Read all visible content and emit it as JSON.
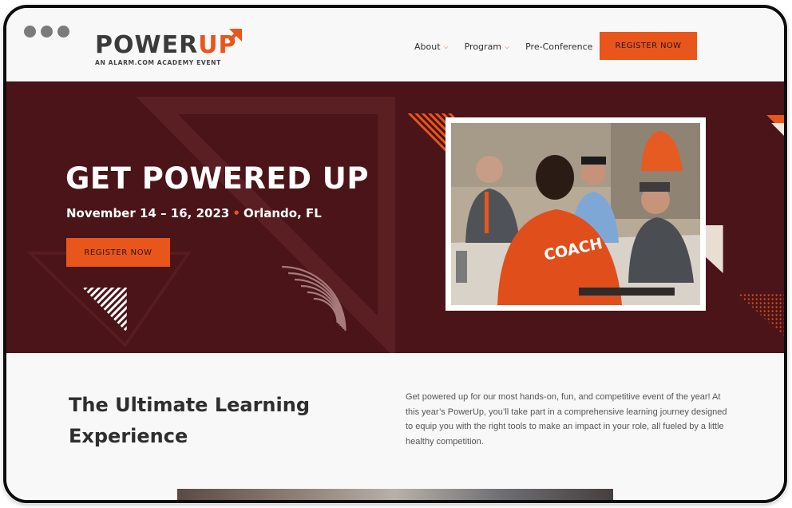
{
  "window": {
    "controls": [
      "dot",
      "dot",
      "dot"
    ]
  },
  "header": {
    "logo": {
      "power": "POWER",
      "up": "UP",
      "subtitle": "AN ALARM.COM ACADEMY EVENT"
    },
    "nav": [
      {
        "label": "About",
        "has_dropdown": true
      },
      {
        "label": "Program",
        "has_dropdown": true
      },
      {
        "label": "Pre-Conference",
        "has_dropdown": false
      }
    ],
    "register_label": "REGISTER NOW"
  },
  "hero": {
    "title": "GET POWERED UP",
    "dates": "November 14 – 16, 2023",
    "separator": "•",
    "location": "Orlando, FL",
    "register_label": "REGISTER NOW",
    "photo_caption": "COACH"
  },
  "content": {
    "title": "The Ultimate Learning Experience",
    "body": "Get powered up for our most hands-on, fun, and competitive event of the year! At this year’s PowerUp, you’ll take part in a comprehensive learning journey designed to equip you with the right tools to make an impact in your role, all fueled by a little healthy competition."
  },
  "colors": {
    "accent": "#e8561c",
    "hero_bg": "#4a1418",
    "text_dark": "#2e2e2e",
    "page_bg": "#f8f8f8"
  },
  "icons": {
    "dropdown": "chevron-down-icon",
    "logo_mark": "arrow-up-right-icon"
  }
}
